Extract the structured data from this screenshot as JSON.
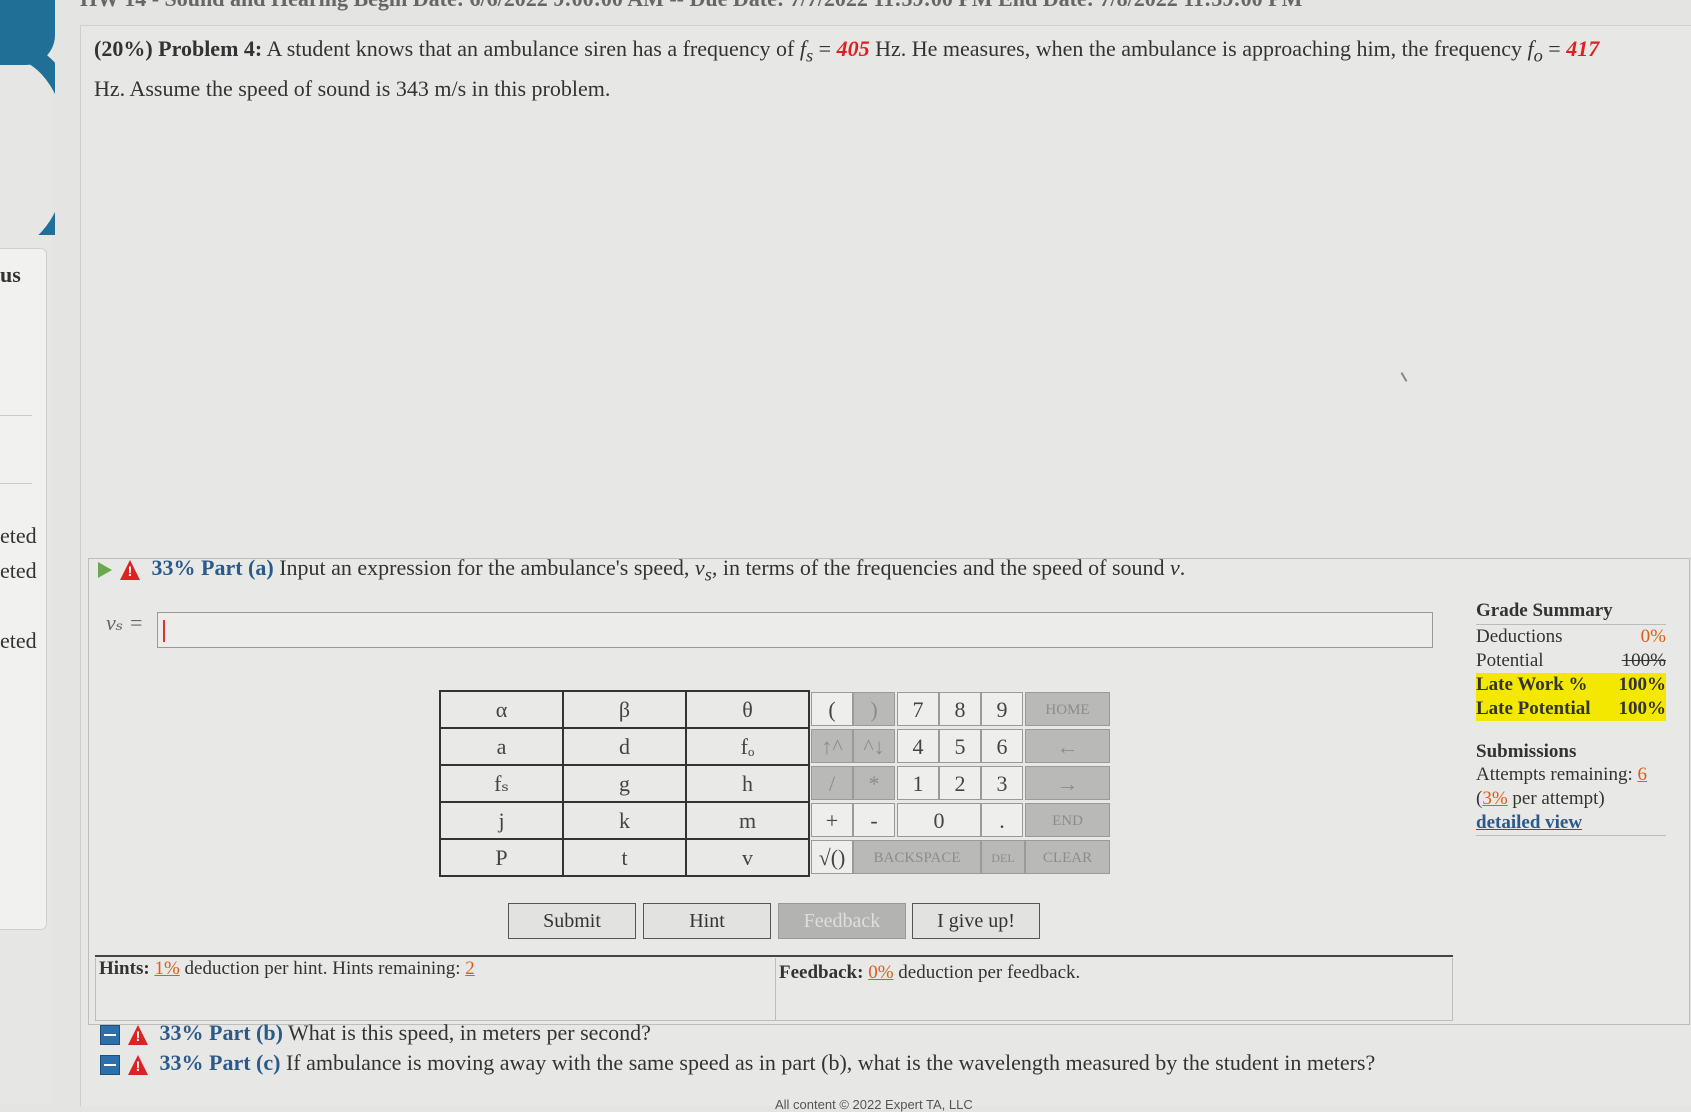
{
  "header": {
    "title_clipped": "HW 14 - Sound and Hearing Begin Date: 6/6/2022 9:00:00 AM -- Due Date: 7/7/2022 11:59:00 PM End Date: 7/8/2022 11:59:00 PM"
  },
  "sidebar": {
    "texts": [
      "us",
      "eted",
      "eted",
      "eted"
    ]
  },
  "problem": {
    "weight": "(20%)",
    "title": "Problem 4:",
    "text_1": "A student knows that an ambulance siren has a frequency of",
    "fs_sym": "f",
    "fs_sub": "s",
    "fs_value": "405",
    "text_2": "Hz. He measures, when the ambulance is approaching him, the frequency",
    "fo_sym": "f",
    "fo_sub": "o",
    "fo_value": "417",
    "text_3": "Hz. Assume the speed of sound is 343 m/s in this problem."
  },
  "part_a": {
    "percent": "33% Part (a)",
    "question": "Input an expression for the ambulance's speed,",
    "var": "v",
    "var_sub": "s",
    "question_end": ", in terms of the frequencies and the speed of sound",
    "v": "v",
    "dot": ".",
    "answer_label": "vₛ =",
    "answer_value": ""
  },
  "symbols": [
    [
      "α",
      "β",
      "θ"
    ],
    [
      "a",
      "d",
      "fₒ"
    ],
    [
      "fₛ",
      "g",
      "h"
    ],
    [
      "j",
      "k",
      "m"
    ],
    [
      "P",
      "t",
      "v"
    ]
  ],
  "keypad": {
    "lparen": "(",
    "rparen": ")",
    "k7": "7",
    "k8": "8",
    "k9": "9",
    "home": "HOME",
    "up": "↑^",
    "down": "^↓",
    "k4": "4",
    "k5": "5",
    "k6": "6",
    "left": "←",
    "div": "/",
    "mul": "*",
    "k1": "1",
    "k2": "2",
    "k3": "3",
    "right": "→",
    "plus": "+",
    "minus": "-",
    "k0": "0",
    "dot": ".",
    "end": "END",
    "sqrt": "√()",
    "backspace": "BACKSPACE",
    "del": "DEL",
    "clear": "CLEAR"
  },
  "buttons": {
    "submit": "Submit",
    "hint": "Hint",
    "feedback": "Feedback",
    "give_up": "I give up!"
  },
  "grade": {
    "title": "Grade Summary",
    "deductions_label": "Deductions",
    "deductions_value": "0%",
    "potential_label": "Potential",
    "potential_value": "100%",
    "late_work_label": "Late Work %",
    "late_work_value": "100%",
    "late_potential_label": "Late Potential",
    "late_potential_value": "100%",
    "submissions_title": "Submissions",
    "attempts_label": "Attempts remaining:",
    "attempts_value": "6",
    "per_attempt_open": "(",
    "per_attempt_value": "3%",
    "per_attempt_text": "per attempt)",
    "detailed_view": "detailed view"
  },
  "hints": {
    "label": "Hints:",
    "deduction": "1%",
    "text": "deduction per hint. Hints remaining:",
    "remaining": "2"
  },
  "feedback": {
    "label": "Feedback:",
    "deduction": "0%",
    "text": "deduction per feedback."
  },
  "part_b": {
    "percent": "33% Part (b)",
    "question": "What is this speed, in meters per second?"
  },
  "part_c": {
    "percent": "33% Part (c)",
    "question": "If ambulance is moving away with the same speed as in part (b), what is the wavelength measured by the student in meters?"
  },
  "footer": "All content © 2022 Expert TA, LLC"
}
